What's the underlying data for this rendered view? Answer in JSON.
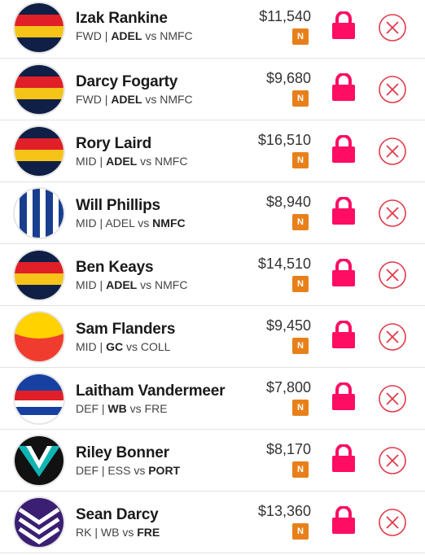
{
  "colors": {
    "lock": "#ff0d63",
    "remove": "#e23a4a",
    "badge": "#e8801a"
  },
  "players": [
    {
      "name": "Izak Rankine",
      "pos": "FWD",
      "team": "ADEL",
      "opp": "NMFC",
      "bold": "team",
      "price": "$11,540",
      "badge": "N",
      "jersey": "adelaide"
    },
    {
      "name": "Darcy Fogarty",
      "pos": "FWD",
      "team": "ADEL",
      "opp": "NMFC",
      "bold": "team",
      "price": "$9,680",
      "badge": "N",
      "jersey": "adelaide"
    },
    {
      "name": "Rory Laird",
      "pos": "MID",
      "team": "ADEL",
      "opp": "NMFC",
      "bold": "team",
      "price": "$16,510",
      "badge": "N",
      "jersey": "adelaide"
    },
    {
      "name": "Will Phillips",
      "pos": "MID",
      "team": "ADEL",
      "opp": "NMFC",
      "bold": "opp",
      "price": "$8,940",
      "badge": "N",
      "jersey": "north-melbourne"
    },
    {
      "name": "Ben Keays",
      "pos": "MID",
      "team": "ADEL",
      "opp": "NMFC",
      "bold": "team",
      "price": "$14,510",
      "badge": "N",
      "jersey": "adelaide"
    },
    {
      "name": "Sam Flanders",
      "pos": "MID",
      "team": "GC",
      "opp": "COLL",
      "bold": "team",
      "price": "$9,450",
      "badge": "N",
      "jersey": "gold-coast"
    },
    {
      "name": "Laitham Vandermeer",
      "pos": "DEF",
      "team": "WB",
      "opp": "FRE",
      "bold": "team",
      "price": "$7,800",
      "badge": "N",
      "jersey": "western-bulldogs"
    },
    {
      "name": "Riley Bonner",
      "pos": "DEF",
      "team": "ESS",
      "opp": "PORT",
      "bold": "opp",
      "price": "$8,170",
      "badge": "N",
      "jersey": "port-adelaide"
    },
    {
      "name": "Sean Darcy",
      "pos": "RK",
      "team": "WB",
      "opp": "FRE",
      "bold": "opp",
      "price": "$13,360",
      "badge": "N",
      "jersey": "fremantle"
    }
  ],
  "labels": {
    "sep": " | ",
    "vs": " vs "
  }
}
